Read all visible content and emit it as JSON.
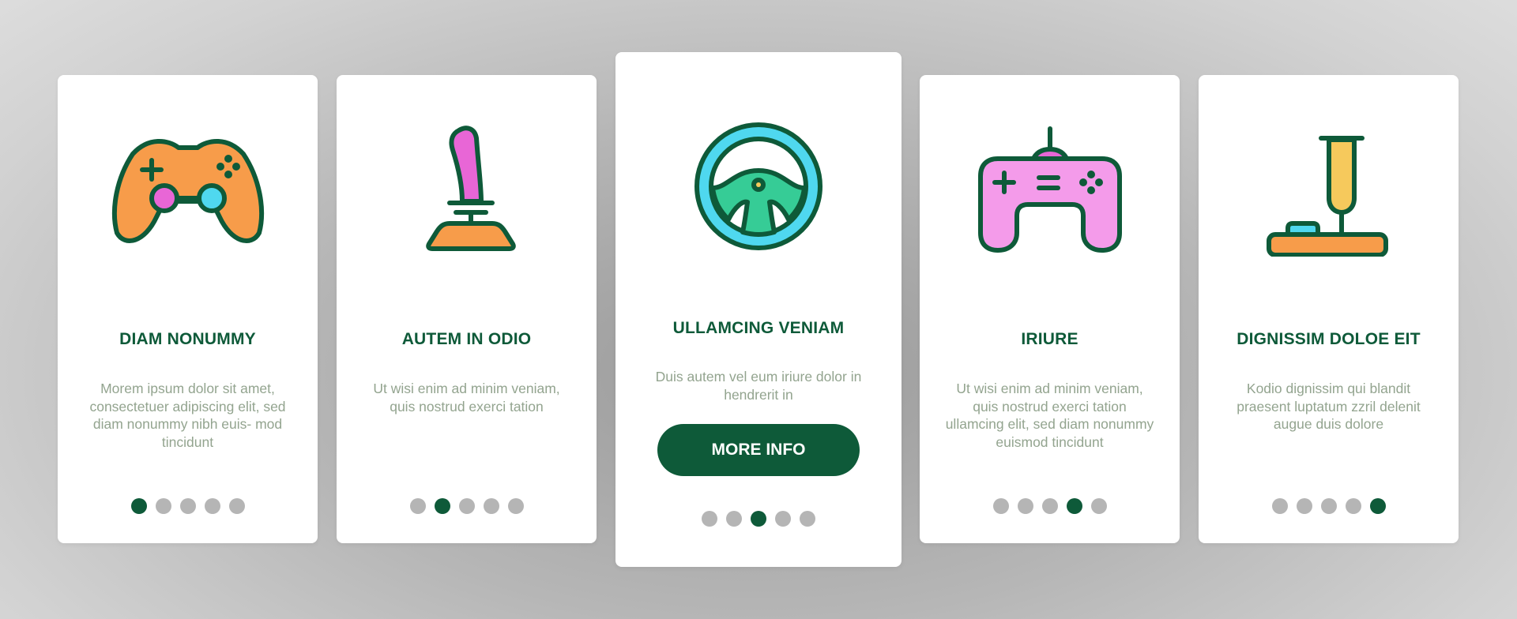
{
  "colors": {
    "brand_dark_green": "#0e5a39",
    "desc_text": "#93a48f",
    "dot_inactive": "#b5b5b5",
    "orange": "#f79c4a",
    "pink": "#e866d6",
    "light_pink": "#f49bea",
    "cyan": "#4fd8ef",
    "mint": "#36cc96",
    "yellow": "#f6c95c"
  },
  "cards": [
    {
      "icon": "gamepad-icon",
      "title": "DIAM NONUMMY",
      "description": "Morem ipsum dolor sit amet, consectetuer adipiscing elit, sed diam nonummy nibh euis- mod tincidunt",
      "page_index": 1,
      "page_count": 5
    },
    {
      "icon": "joystick-lever-icon",
      "title": "AUTEM IN ODIO",
      "description": "Ut wisi enim ad minim veniam, quis nostrud exerci tation",
      "page_index": 2,
      "page_count": 5
    },
    {
      "icon": "steering-wheel-icon",
      "title": "ULLAMCING VENIAM",
      "description": "Duis autem vel eum iriure dolor in hendrerit in",
      "button_label": "MORE INFO",
      "page_index": 3,
      "page_count": 5
    },
    {
      "icon": "wired-gamepad-icon",
      "title": "IRIURE",
      "description": "Ut wisi enim ad minim veniam, quis nostrud exerci tation ullamcing elit, sed diam nonummy euismod tincidunt",
      "page_index": 4,
      "page_count": 5
    },
    {
      "icon": "arcade-joystick-icon",
      "title": "DIGNISSIM DOLOE EIT",
      "description": "Kodio dignissim qui blandit praesent luptatum zzril delenit augue duis dolore",
      "page_index": 5,
      "page_count": 5
    }
  ]
}
